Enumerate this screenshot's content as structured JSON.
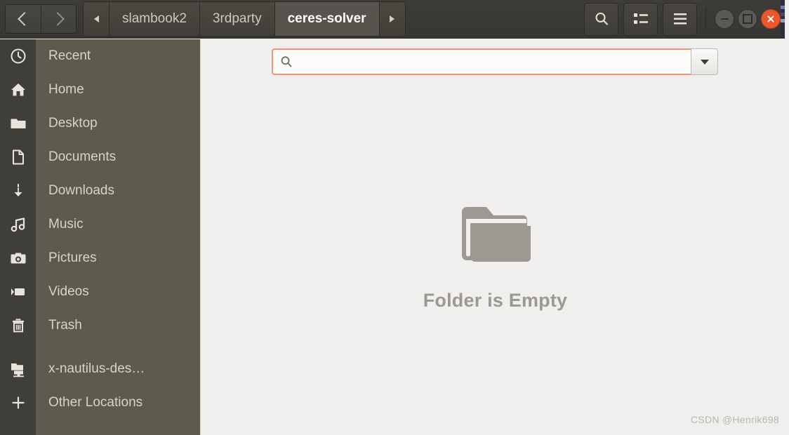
{
  "window": {
    "title": "ceres-solver",
    "nav": {
      "back_label": "Back",
      "forward_label": "Forward"
    },
    "controls": {
      "minimize_label": "Minimize",
      "maximize_label": "Maximize",
      "close_label": "Close",
      "close_color": "#e9572b"
    }
  },
  "pathbar": {
    "scroll_prev_label": "Scroll path left",
    "scroll_next_label": "Scroll path right",
    "crumbs": [
      {
        "label": "slambook2",
        "active": false
      },
      {
        "label": "3rdparty",
        "active": false
      },
      {
        "label": "ceres-solver",
        "active": true
      }
    ]
  },
  "toolbar": {
    "search_button_label": "Search",
    "view_button_label": "View options",
    "menu_button_label": "Menu"
  },
  "search": {
    "value": "",
    "placeholder": "",
    "icon": "search-icon",
    "dropdown_label": "Search options",
    "focus_color": "#ef9572"
  },
  "sidebar": {
    "items": [
      {
        "label": "Recent",
        "icon": "clock-icon",
        "gap": false
      },
      {
        "label": "Home",
        "icon": "home-icon",
        "gap": false
      },
      {
        "label": "Desktop",
        "icon": "folder-icon",
        "gap": false
      },
      {
        "label": "Documents",
        "icon": "document-icon",
        "gap": false
      },
      {
        "label": "Downloads",
        "icon": "download-icon",
        "gap": false
      },
      {
        "label": "Music",
        "icon": "music-icon",
        "gap": false
      },
      {
        "label": "Pictures",
        "icon": "camera-icon",
        "gap": false
      },
      {
        "label": "Videos",
        "icon": "video-icon",
        "gap": false
      },
      {
        "label": "Trash",
        "icon": "trash-icon",
        "gap": false
      },
      {
        "label": "x-nautilus-des…",
        "icon": "network-icon",
        "gap": true
      },
      {
        "label": "Other Locations",
        "icon": "plus-icon",
        "gap": false
      }
    ]
  },
  "main": {
    "empty_message": "Folder is Empty",
    "empty_icon": "folder-icon"
  },
  "watermark": {
    "text": "CSDN @Henrik698"
  }
}
